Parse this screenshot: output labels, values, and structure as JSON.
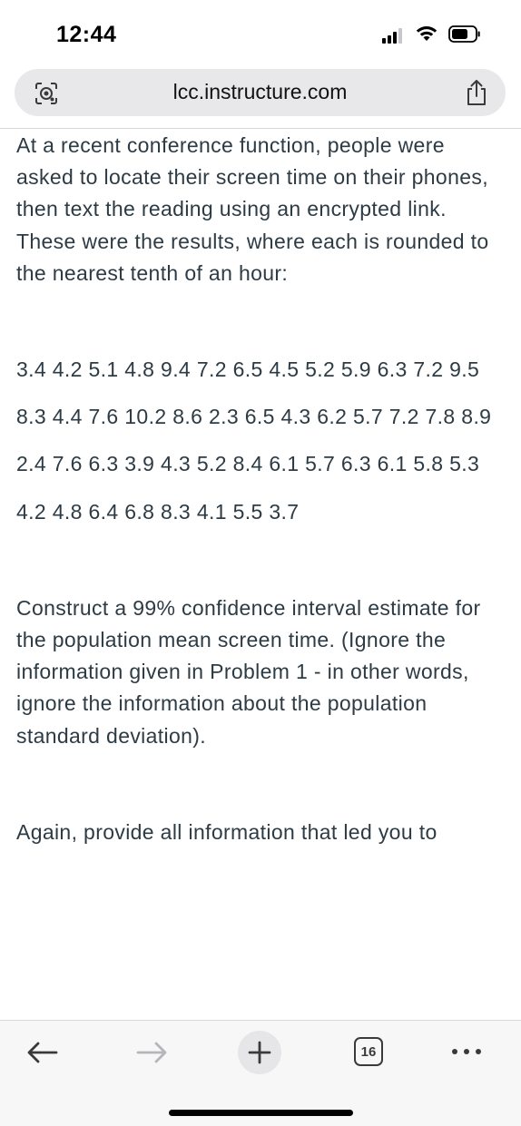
{
  "status_bar": {
    "time": "12:44",
    "icons": [
      "cellular-signal-icon",
      "wifi-icon",
      "battery-icon"
    ]
  },
  "browser": {
    "url": "lcc.instructure.com",
    "icons": [
      "visual-lookup-icon",
      "share-icon"
    ]
  },
  "content": {
    "intro": "At a recent conference function, people were asked to locate their screen time on their phones, then text the reading using an encrypted link. These were the results, where each is rounded to the nearest tenth of an hour:",
    "data_lines": [
      "3.4 4.2 5.1 4.8 9.4 7.2 6.5 4.5 5.2 5.9 6.3 7.2 9.5",
      "8.3 4.4 7.6 10.2 8.6 2.3 6.5 4.3 6.2 5.7 7.2 7.8 8.9",
      "2.4 7.6 6.3 3.9 4.3 5.2 8.4 6.1 5.7 6.3 6.1 5.8 5.3",
      "4.2 4.8 6.4 6.8 8.3 4.1 5.5 3.7"
    ],
    "task": "Construct a 99% confidence interval estimate for the population mean screen time. (Ignore the information given in Problem 1 - in other words, ignore the information about the population standard deviation).",
    "again": "Again, provide all information that led you to"
  },
  "toolbar": {
    "tab_count": "16",
    "icons": [
      "back-arrow-icon",
      "forward-arrow-icon",
      "plus-icon",
      "tabs-icon",
      "more-icon"
    ]
  }
}
